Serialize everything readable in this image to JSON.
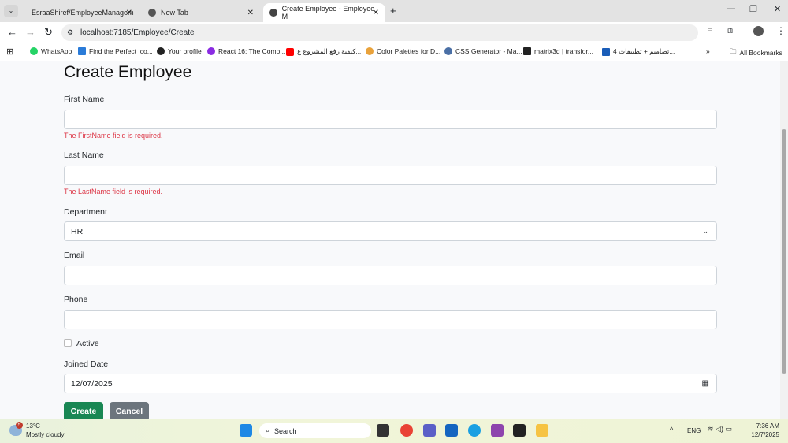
{
  "browser": {
    "tabs": [
      {
        "label": "EsraaShiref/EmployeeManagem"
      },
      {
        "label": "New Tab"
      },
      {
        "label": "Create Employee - Employee M"
      }
    ],
    "url": "localhost:7185/Employee/Create",
    "bookmarks": [
      "WhatsApp",
      "Find the Perfect Ico...",
      "Your profile",
      "React 16: The Comp...",
      "كيفية رفع المشروع ع...",
      "Color Palettes for D...",
      "CSS Generator - Ma...",
      "matrix3d | transfor...",
      "4 تصاميم + تطبيقات..."
    ],
    "all_bookmarks": "All Bookmarks"
  },
  "form": {
    "title": "Create Employee",
    "first_name_label": "First Name",
    "first_name_value": "",
    "first_name_error": "The FirstName field is required.",
    "last_name_label": "Last Name",
    "last_name_value": "",
    "last_name_error": "The LastName field is required.",
    "department_label": "Department",
    "department_value": "HR",
    "email_label": "Email",
    "email_value": "",
    "phone_label": "Phone",
    "phone_value": "",
    "active_label": "Active",
    "joined_label": "Joined Date",
    "joined_value": "12/07/2025",
    "create_label": "Create",
    "cancel_label": "Cancel"
  },
  "taskbar": {
    "temp": "13°C",
    "weather": "Mostly cloudy",
    "search": "Search",
    "lang": "ENG",
    "time": "7:36 AM",
    "date": "12/7/2025",
    "badge": "5"
  },
  "colors": {
    "primary": "#198754",
    "secondary": "#6c757d",
    "error": "#dc3545"
  }
}
